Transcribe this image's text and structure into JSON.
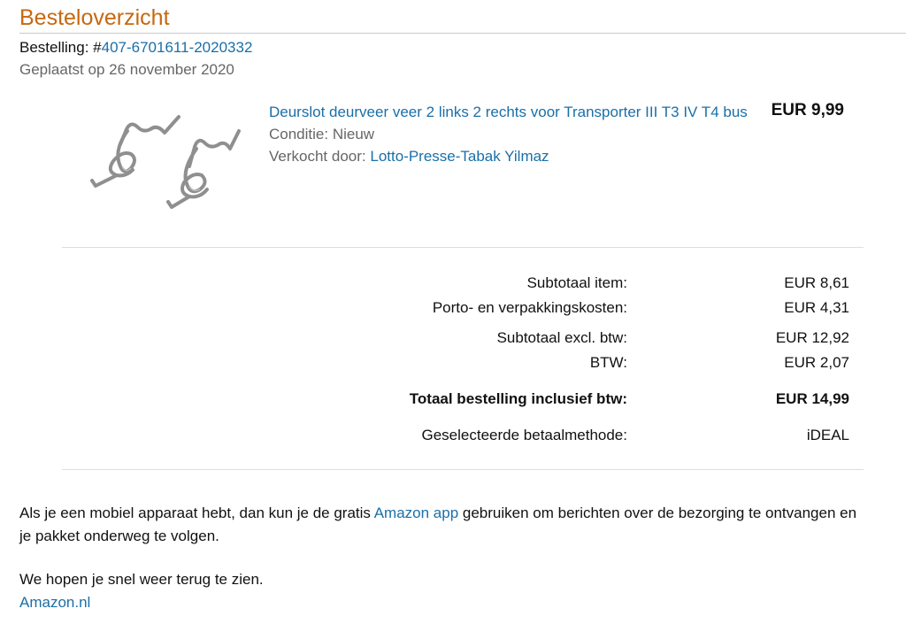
{
  "header": {
    "title": "Besteloverzicht"
  },
  "order": {
    "number_label": "Bestelling: #",
    "number": "407-6701611-2020332",
    "placed": "Geplaatst op 26 november 2020"
  },
  "product": {
    "title": "Deurslot deurveer veer 2 links 2 rechts voor Transporter III T3 IV T4 bus",
    "condition_label": "Conditie:",
    "condition_value": "Nieuw",
    "seller_label": "Verkocht door:",
    "seller_name": "Lotto-Presse-Tabak Yilmaz",
    "price": "EUR 9,99",
    "image_icon": "spring-image"
  },
  "summary": [
    {
      "label": "Subtotaal item:",
      "value": "EUR 8,61"
    },
    {
      "label": "Porto- en verpakkingskosten:",
      "value": "EUR 4,31"
    },
    {
      "label": "Subtotaal excl. btw:",
      "value": "EUR 12,92"
    },
    {
      "label": "BTW:",
      "value": "EUR 2,07"
    },
    {
      "label": "Totaal bestelling inclusief btw:",
      "value": "EUR 14,99"
    },
    {
      "label": "Geselecteerde betaalmethode:",
      "value": "iDEAL"
    }
  ],
  "footer": {
    "mobile_before": "Als je een mobiel apparaat hebt, dan kun je de gratis ",
    "mobile_link": "Amazon app",
    "mobile_after": " gebruiken om berichten over de bezorging te ontvangen en je pakket onderweg te volgen.",
    "closing": "We hopen je snel weer terug te zien.",
    "signature_link": "Amazon.nl"
  },
  "colors": {
    "accent": "#c7680f",
    "link": "#1a6fa8",
    "muted": "#666666"
  }
}
